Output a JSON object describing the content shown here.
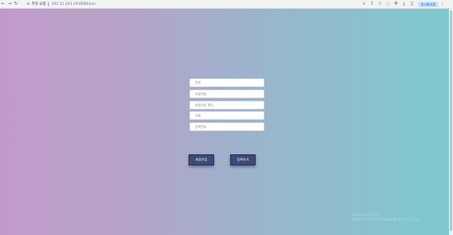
{
  "browser": {
    "security_label": "주의 요함",
    "address": "202.31.243.19:8080/join",
    "profile_label": "일시중지됨"
  },
  "form": {
    "fields": [
      {
        "placeholder": "학번"
      },
      {
        "placeholder": "비밀번호"
      },
      {
        "placeholder": "비밀번호 확인"
      },
      {
        "placeholder": "이름"
      },
      {
        "placeholder": "전화번호"
      }
    ],
    "back_button": "회원가입",
    "submit_button": "등록하기"
  },
  "watermark": {
    "line1": "Windows 정품 인증",
    "line2": "[설정]으로 이동하여 Windows를 정품 인증합니다."
  }
}
